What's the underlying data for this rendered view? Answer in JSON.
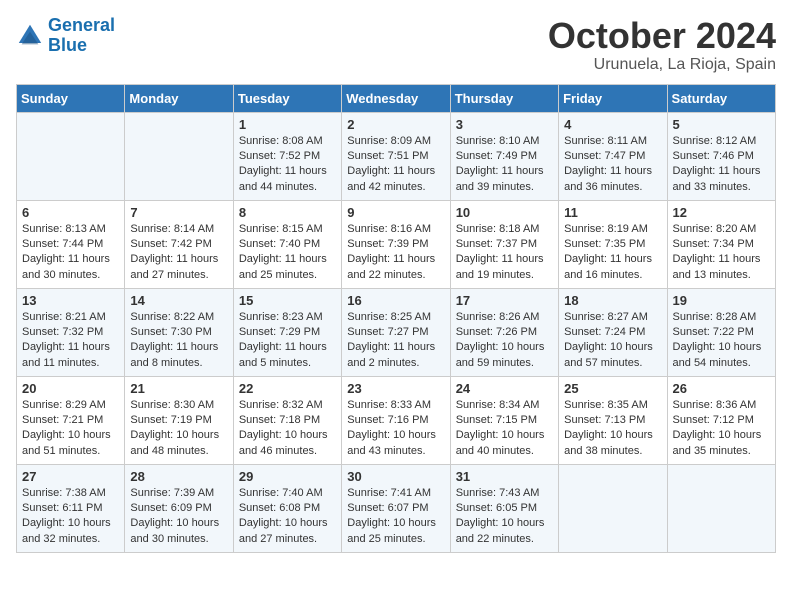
{
  "header": {
    "logo_line1": "General",
    "logo_line2": "Blue",
    "month_title": "October 2024",
    "subtitle": "Urunuela, La Rioja, Spain"
  },
  "days_of_week": [
    "Sunday",
    "Monday",
    "Tuesday",
    "Wednesday",
    "Thursday",
    "Friday",
    "Saturday"
  ],
  "weeks": [
    [
      {
        "day": "",
        "info": ""
      },
      {
        "day": "",
        "info": ""
      },
      {
        "day": "1",
        "info": "Sunrise: 8:08 AM\nSunset: 7:52 PM\nDaylight: 11 hours and 44 minutes."
      },
      {
        "day": "2",
        "info": "Sunrise: 8:09 AM\nSunset: 7:51 PM\nDaylight: 11 hours and 42 minutes."
      },
      {
        "day": "3",
        "info": "Sunrise: 8:10 AM\nSunset: 7:49 PM\nDaylight: 11 hours and 39 minutes."
      },
      {
        "day": "4",
        "info": "Sunrise: 8:11 AM\nSunset: 7:47 PM\nDaylight: 11 hours and 36 minutes."
      },
      {
        "day": "5",
        "info": "Sunrise: 8:12 AM\nSunset: 7:46 PM\nDaylight: 11 hours and 33 minutes."
      }
    ],
    [
      {
        "day": "6",
        "info": "Sunrise: 8:13 AM\nSunset: 7:44 PM\nDaylight: 11 hours and 30 minutes."
      },
      {
        "day": "7",
        "info": "Sunrise: 8:14 AM\nSunset: 7:42 PM\nDaylight: 11 hours and 27 minutes."
      },
      {
        "day": "8",
        "info": "Sunrise: 8:15 AM\nSunset: 7:40 PM\nDaylight: 11 hours and 25 minutes."
      },
      {
        "day": "9",
        "info": "Sunrise: 8:16 AM\nSunset: 7:39 PM\nDaylight: 11 hours and 22 minutes."
      },
      {
        "day": "10",
        "info": "Sunrise: 8:18 AM\nSunset: 7:37 PM\nDaylight: 11 hours and 19 minutes."
      },
      {
        "day": "11",
        "info": "Sunrise: 8:19 AM\nSunset: 7:35 PM\nDaylight: 11 hours and 16 minutes."
      },
      {
        "day": "12",
        "info": "Sunrise: 8:20 AM\nSunset: 7:34 PM\nDaylight: 11 hours and 13 minutes."
      }
    ],
    [
      {
        "day": "13",
        "info": "Sunrise: 8:21 AM\nSunset: 7:32 PM\nDaylight: 11 hours and 11 minutes."
      },
      {
        "day": "14",
        "info": "Sunrise: 8:22 AM\nSunset: 7:30 PM\nDaylight: 11 hours and 8 minutes."
      },
      {
        "day": "15",
        "info": "Sunrise: 8:23 AM\nSunset: 7:29 PM\nDaylight: 11 hours and 5 minutes."
      },
      {
        "day": "16",
        "info": "Sunrise: 8:25 AM\nSunset: 7:27 PM\nDaylight: 11 hours and 2 minutes."
      },
      {
        "day": "17",
        "info": "Sunrise: 8:26 AM\nSunset: 7:26 PM\nDaylight: 10 hours and 59 minutes."
      },
      {
        "day": "18",
        "info": "Sunrise: 8:27 AM\nSunset: 7:24 PM\nDaylight: 10 hours and 57 minutes."
      },
      {
        "day": "19",
        "info": "Sunrise: 8:28 AM\nSunset: 7:22 PM\nDaylight: 10 hours and 54 minutes."
      }
    ],
    [
      {
        "day": "20",
        "info": "Sunrise: 8:29 AM\nSunset: 7:21 PM\nDaylight: 10 hours and 51 minutes."
      },
      {
        "day": "21",
        "info": "Sunrise: 8:30 AM\nSunset: 7:19 PM\nDaylight: 10 hours and 48 minutes."
      },
      {
        "day": "22",
        "info": "Sunrise: 8:32 AM\nSunset: 7:18 PM\nDaylight: 10 hours and 46 minutes."
      },
      {
        "day": "23",
        "info": "Sunrise: 8:33 AM\nSunset: 7:16 PM\nDaylight: 10 hours and 43 minutes."
      },
      {
        "day": "24",
        "info": "Sunrise: 8:34 AM\nSunset: 7:15 PM\nDaylight: 10 hours and 40 minutes."
      },
      {
        "day": "25",
        "info": "Sunrise: 8:35 AM\nSunset: 7:13 PM\nDaylight: 10 hours and 38 minutes."
      },
      {
        "day": "26",
        "info": "Sunrise: 8:36 AM\nSunset: 7:12 PM\nDaylight: 10 hours and 35 minutes."
      }
    ],
    [
      {
        "day": "27",
        "info": "Sunrise: 7:38 AM\nSunset: 6:11 PM\nDaylight: 10 hours and 32 minutes."
      },
      {
        "day": "28",
        "info": "Sunrise: 7:39 AM\nSunset: 6:09 PM\nDaylight: 10 hours and 30 minutes."
      },
      {
        "day": "29",
        "info": "Sunrise: 7:40 AM\nSunset: 6:08 PM\nDaylight: 10 hours and 27 minutes."
      },
      {
        "day": "30",
        "info": "Sunrise: 7:41 AM\nSunset: 6:07 PM\nDaylight: 10 hours and 25 minutes."
      },
      {
        "day": "31",
        "info": "Sunrise: 7:43 AM\nSunset: 6:05 PM\nDaylight: 10 hours and 22 minutes."
      },
      {
        "day": "",
        "info": ""
      },
      {
        "day": "",
        "info": ""
      }
    ]
  ]
}
